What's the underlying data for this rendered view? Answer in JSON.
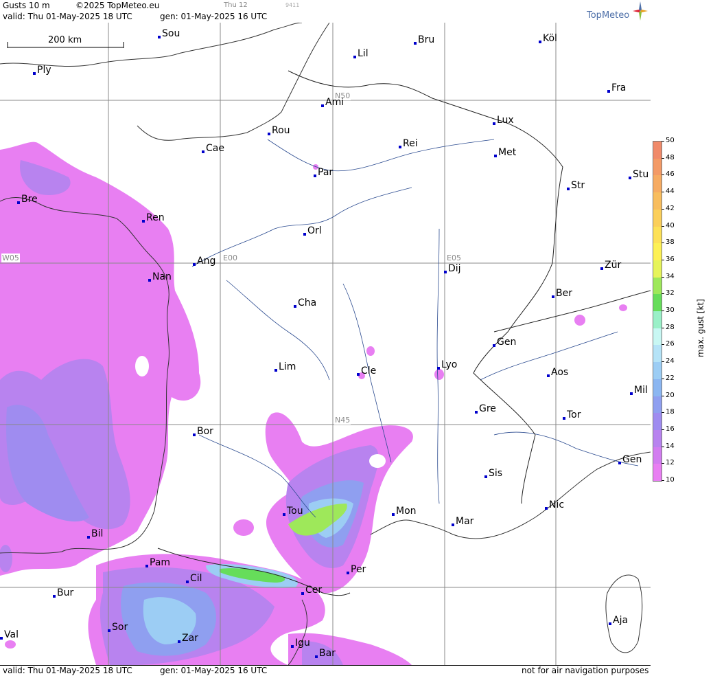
{
  "header": {
    "product": "Gusts 10 m",
    "copyright": "©2025 TopMeteo.eu",
    "run_small": "Thu 12",
    "code_small": "9411",
    "valid": "valid:  Thu  01-May-2025  18 UTC",
    "gen": "gen: 01-May-2025 16 UTC",
    "brand": "TopMeteo"
  },
  "footer": {
    "valid": "valid:  Thu  01-May-2025  18 UTC",
    "gen": "gen: 01-May-2025 16 UTC",
    "disclaimer": "not for air navigation purposes"
  },
  "scale": {
    "label": "200 km"
  },
  "grid_labels": {
    "n50": "N50",
    "n45": "N45",
    "w05": "W05",
    "e00": "E00",
    "e05": "E05"
  },
  "cities": [
    {
      "id": "sou",
      "name": "Sou"
    },
    {
      "id": "bru",
      "name": "Bru"
    },
    {
      "id": "kol",
      "name": "Köl"
    },
    {
      "id": "ply",
      "name": "Ply"
    },
    {
      "id": "lil",
      "name": "Lil"
    },
    {
      "id": "ami",
      "name": "Ami"
    },
    {
      "id": "fra",
      "name": "Fra"
    },
    {
      "id": "rou",
      "name": "Rou"
    },
    {
      "id": "lux",
      "name": "Lux"
    },
    {
      "id": "cae",
      "name": "Cae"
    },
    {
      "id": "rei",
      "name": "Rei"
    },
    {
      "id": "met",
      "name": "Met"
    },
    {
      "id": "par",
      "name": "Par"
    },
    {
      "id": "bre",
      "name": "Bre"
    },
    {
      "id": "str",
      "name": "Str"
    },
    {
      "id": "stu",
      "name": "Stu"
    },
    {
      "id": "ren",
      "name": "Ren"
    },
    {
      "id": "orl",
      "name": "Orl"
    },
    {
      "id": "ang",
      "name": "Ang"
    },
    {
      "id": "dij",
      "name": "Dij"
    },
    {
      "id": "zur",
      "name": "Zür"
    },
    {
      "id": "nan",
      "name": "Nan"
    },
    {
      "id": "ber",
      "name": "Ber"
    },
    {
      "id": "cha",
      "name": "Cha"
    },
    {
      "id": "gen1",
      "name": "Gen"
    },
    {
      "id": "lim",
      "name": "Lim"
    },
    {
      "id": "cle",
      "name": "Cle"
    },
    {
      "id": "lyo",
      "name": "Lyo"
    },
    {
      "id": "aos",
      "name": "Aos"
    },
    {
      "id": "mil",
      "name": "Mil"
    },
    {
      "id": "gre",
      "name": "Gre"
    },
    {
      "id": "bor",
      "name": "Bor"
    },
    {
      "id": "tor",
      "name": "Tor"
    },
    {
      "id": "gen2",
      "name": "Gen"
    },
    {
      "id": "sis",
      "name": "Sis"
    },
    {
      "id": "tou",
      "name": "Tou"
    },
    {
      "id": "mon",
      "name": "Mon"
    },
    {
      "id": "nic",
      "name": "Nic"
    },
    {
      "id": "mar",
      "name": "Mar"
    },
    {
      "id": "bil",
      "name": "Bil"
    },
    {
      "id": "pam",
      "name": "Pam"
    },
    {
      "id": "per",
      "name": "Per"
    },
    {
      "id": "cil",
      "name": "Cil"
    },
    {
      "id": "cer",
      "name": "Cer"
    },
    {
      "id": "bur",
      "name": "Bur"
    },
    {
      "id": "aja",
      "name": "Aja"
    },
    {
      "id": "sor",
      "name": "Sor"
    },
    {
      "id": "val",
      "name": "Val"
    },
    {
      "id": "zar",
      "name": "Zar"
    },
    {
      "id": "igu",
      "name": "Igu"
    },
    {
      "id": "bar",
      "name": "Bar"
    }
  ],
  "legend": {
    "title": "max. gust [kt]",
    "ticks": [
      "50",
      "48",
      "46",
      "44",
      "42",
      "40",
      "38",
      "36",
      "34",
      "32",
      "30",
      "28",
      "26",
      "24",
      "22",
      "20",
      "18",
      "16",
      "14",
      "12",
      "10"
    ],
    "colors": [
      "#f08a6a",
      "#f39a66",
      "#f6ab62",
      "#f8bd5e",
      "#fbcf5a",
      "#fde157",
      "#fdf155",
      "#e6f45a",
      "#9ee85a",
      "#66dd5a",
      "#9af0c8",
      "#c8f7f3",
      "#b5e3f7",
      "#9ccdf4",
      "#8bb6f1",
      "#8f9ff0",
      "#9f8cf0",
      "#b883ef",
      "#d27df0",
      "#e87ff2"
    ]
  }
}
